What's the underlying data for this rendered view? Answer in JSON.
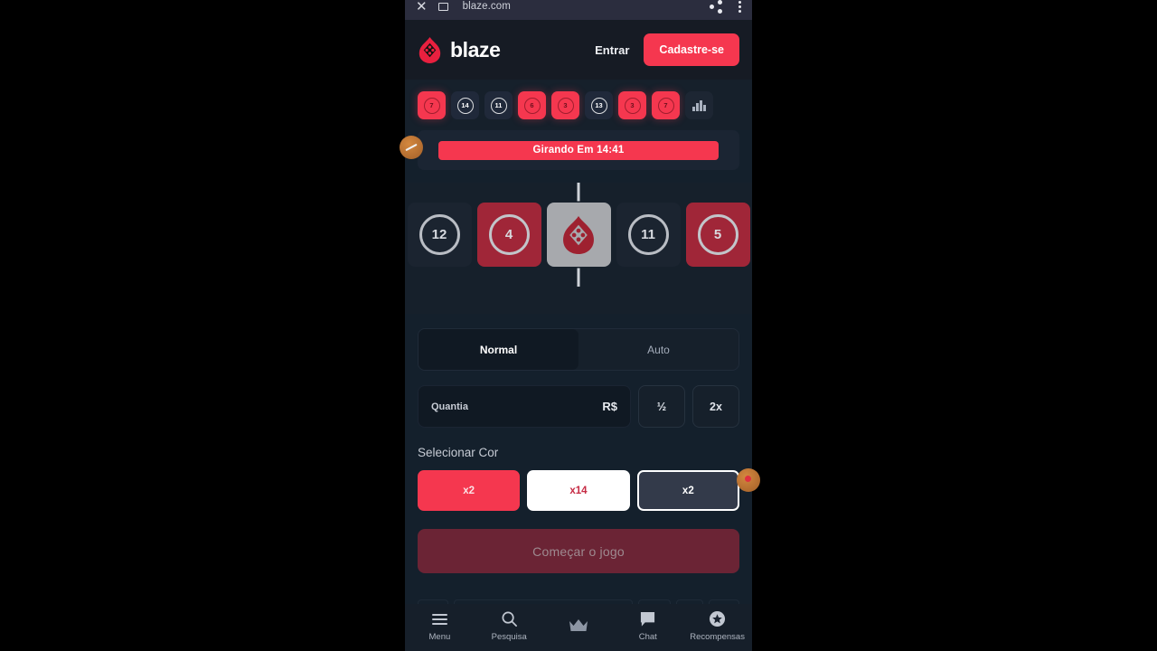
{
  "browser": {
    "url": "blaze.com",
    "close_icon": "close-icon",
    "lock_icon": "lock-icon",
    "share_icon": "share-icon",
    "menu_icon": "overflow-menu-icon"
  },
  "header": {
    "brand": "blaze",
    "login_label": "Entrar",
    "signup_label": "Cadastre-se",
    "accent_red": "#f5374f"
  },
  "history": {
    "items": [
      {
        "value": "7",
        "color": "red"
      },
      {
        "value": "14",
        "color": "black"
      },
      {
        "value": "11",
        "color": "black"
      },
      {
        "value": "6",
        "color": "red"
      },
      {
        "value": "3",
        "color": "red"
      },
      {
        "value": "13",
        "color": "black"
      },
      {
        "value": "3",
        "color": "red"
      },
      {
        "value": "7",
        "color": "red"
      }
    ],
    "stats_icon": "bar-chart-icon"
  },
  "timer": {
    "text": "Girando Em 14:41"
  },
  "carousel": {
    "tiles": [
      {
        "value": "12",
        "color": "black"
      },
      {
        "value": "4",
        "color": "red"
      },
      {
        "value": "",
        "color": "white",
        "icon": "blaze-flame-icon"
      },
      {
        "value": "11",
        "color": "black"
      },
      {
        "value": "5",
        "color": "red"
      }
    ]
  },
  "mode": {
    "tabs": [
      {
        "label": "Normal",
        "active": true
      },
      {
        "label": "Auto",
        "active": false
      }
    ]
  },
  "bet": {
    "amount_label": "Quantia",
    "amount_value": "",
    "currency": "R$",
    "half_label": "½",
    "double_label": "2x"
  },
  "color_select": {
    "title": "Selecionar Cor",
    "options": [
      {
        "label": "x2",
        "color": "red",
        "selected": false
      },
      {
        "label": "x14",
        "color": "white",
        "selected": false
      },
      {
        "label": "x2",
        "color": "black",
        "selected": true
      }
    ]
  },
  "start": {
    "label": "Começar o jogo"
  },
  "bottom_nav": {
    "items": [
      {
        "label": "Menu",
        "icon": "hamburger-menu-icon"
      },
      {
        "label": "Pesquisa",
        "icon": "search-icon"
      },
      {
        "label": "",
        "icon": "crown-icon"
      },
      {
        "label": "Chat",
        "icon": "chat-bubble-icon"
      },
      {
        "label": "Recompensas",
        "icon": "reward-star-icon"
      }
    ]
  }
}
